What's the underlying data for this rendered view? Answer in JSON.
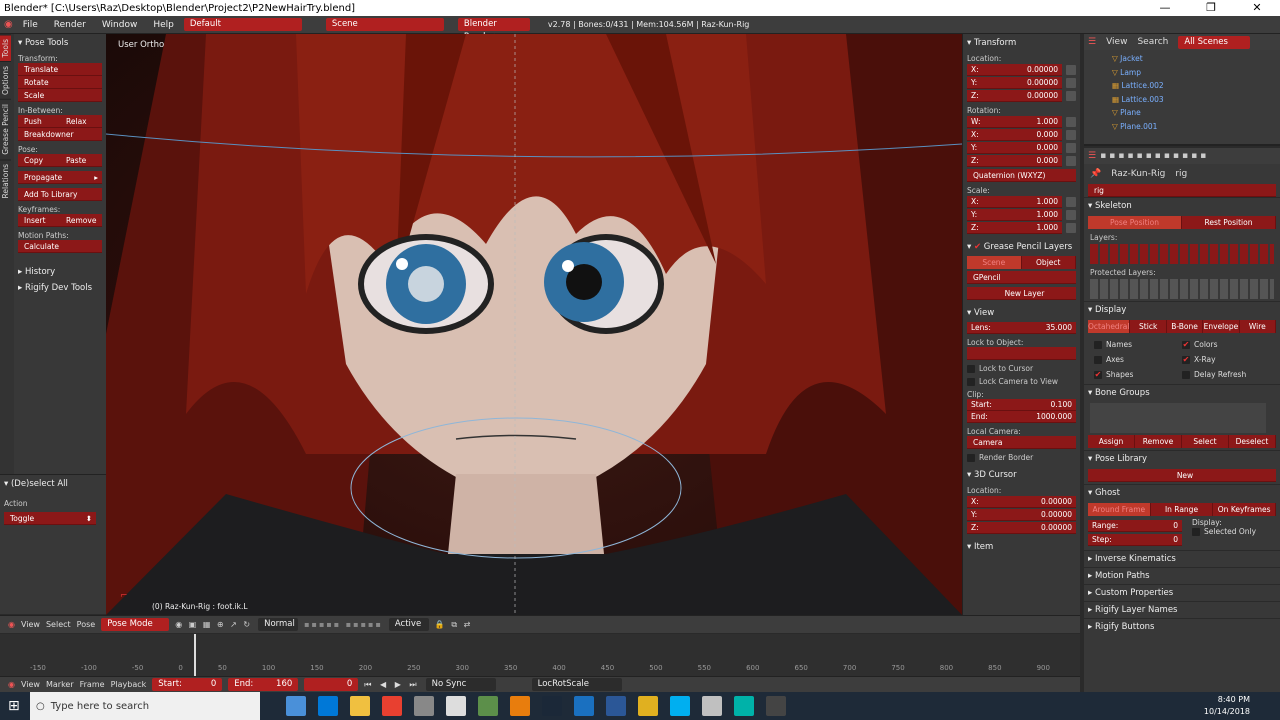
{
  "window": {
    "title": "Blender* [C:\\Users\\Raz\\Desktop\\Blender\\Project2\\P2NewHairTry.blend]",
    "controls": [
      "—",
      "❐",
      "✕"
    ]
  },
  "infobar": {
    "menus": [
      "File",
      "Render",
      "Window",
      "Help"
    ],
    "layout": "Default",
    "scene": "Scene",
    "engine": "Blender Render",
    "stats": "v2.78 | Bones:0/431 | Mem:104.56M | Raz-Kun-Rig"
  },
  "left_tabs": [
    "Tools",
    "Options",
    "Grease Pencil",
    "Relations"
  ],
  "toolshelf": {
    "header": "Pose Tools",
    "transform_label": "Transform:",
    "translate": "Translate",
    "rotate": "Rotate",
    "scale": "Scale",
    "inbetween_label": "In-Between:",
    "push": "Push",
    "relax": "Relax",
    "breakdowner": "Breakdowner",
    "pose_label": "Pose:",
    "copy": "Copy",
    "paste": "Paste",
    "propagate": "Propagate",
    "add_to_library": "Add To Library",
    "keyframes_label": "Keyframes:",
    "insert": "Insert",
    "remove": "Remove",
    "motion_paths_label": "Motion Paths:",
    "calculate": "Calculate",
    "history": "History",
    "rigify": "Rigify Dev Tools"
  },
  "operator": {
    "header": "(De)select All",
    "action_label": "Action",
    "action_value": "Toggle"
  },
  "viewport": {
    "view_label": "User Ortho",
    "object_info": "(0) Raz-Kun-Rig : foot.ik.L"
  },
  "npanel": {
    "transform": "Transform",
    "location": "Location:",
    "loc": [
      {
        "k": "X:",
        "v": "0.00000"
      },
      {
        "k": "Y:",
        "v": "0.00000"
      },
      {
        "k": "Z:",
        "v": "0.00000"
      }
    ],
    "rotation": "Rotation:",
    "rot": [
      {
        "k": "W:",
        "v": "1.000"
      },
      {
        "k": "X:",
        "v": "0.000"
      },
      {
        "k": "Y:",
        "v": "0.000"
      },
      {
        "k": "Z:",
        "v": "0.000"
      }
    ],
    "rot_mode": "Quaternion (WXYZ)",
    "scale": "Scale:",
    "scl": [
      {
        "k": "X:",
        "v": "1.000"
      },
      {
        "k": "Y:",
        "v": "1.000"
      },
      {
        "k": "Z:",
        "v": "1.000"
      }
    ],
    "gp_layers": "Grease Pencil Layers",
    "gp_scene": "Scene",
    "gp_object": "Object",
    "gp_name": "GPencil",
    "new_layer": "New Layer",
    "view": "View",
    "lens_label": "Lens:",
    "lens": "35.000",
    "lock_to_object": "Lock to Object:",
    "lock_to_cursor": "Lock to Cursor",
    "lock_camera": "Lock Camera to View",
    "clip": "Clip:",
    "start_label": "Start:",
    "clip_start": "0.100",
    "end_label": "End:",
    "clip_end": "1000.000",
    "local_camera": "Local Camera:",
    "camera": "Camera",
    "render_border": "Render Border",
    "cursor": "3D Cursor",
    "cursor_location": "Location:",
    "cur": [
      {
        "k": "X:",
        "v": "0.00000"
      },
      {
        "k": "Y:",
        "v": "0.00000"
      },
      {
        "k": "Z:",
        "v": "0.00000"
      }
    ],
    "item": "Item"
  },
  "outliner": {
    "menus": [
      "View",
      "Search"
    ],
    "filter": "All Scenes",
    "items": [
      "Jacket",
      "Lamp",
      "Lattice.002",
      "Lattice.003",
      "Plane",
      "Plane.001"
    ]
  },
  "props": {
    "object": "Raz-Kun-Rig",
    "data": "rig",
    "name_field": "rig",
    "skeleton": "Skeleton",
    "pose_position": "Pose Position",
    "rest_position": "Rest Position",
    "layers": "Layers:",
    "protected_layers": "Protected Layers:",
    "display": "Display",
    "display_modes": [
      "Octahedral",
      "Stick",
      "B-Bone",
      "Envelope",
      "Wire"
    ],
    "names": "Names",
    "colors": "Colors",
    "axes": "Axes",
    "xray": "X-Ray",
    "shapes": "Shapes",
    "delay_refresh": "Delay Refresh",
    "bone_groups": "Bone Groups",
    "assign": "Assign",
    "remove": "Remove",
    "select": "Select",
    "deselect": "Deselect",
    "pose_library": "Pose Library",
    "new": "New",
    "ghost": "Ghost",
    "ghost_modes": [
      "Around Frame",
      "In Range",
      "On Keyframes"
    ],
    "range_label": "Range:",
    "range": "0",
    "step_label": "Step:",
    "step": "0",
    "display_label": "Display:",
    "selected_only": "Selected Only",
    "collapsed": [
      "Inverse Kinematics",
      "Motion Paths",
      "Custom Properties",
      "Rigify Layer Names",
      "Rigify Buttons"
    ]
  },
  "view3d_header": {
    "menus": [
      "View",
      "Select",
      "Pose"
    ],
    "mode": "Pose Mode",
    "normal": "Normal",
    "active": "Active"
  },
  "timeline": {
    "ticks": [
      "-150",
      "-100",
      "-50",
      "0",
      "50",
      "100",
      "150",
      "200",
      "250",
      "300",
      "350",
      "400",
      "450",
      "500",
      "550",
      "600",
      "650",
      "700",
      "750",
      "800",
      "850",
      "900"
    ]
  },
  "timeline_header": {
    "menus": [
      "View",
      "Marker",
      "Frame",
      "Playback"
    ],
    "start_label": "Start:",
    "start": "0",
    "end_label": "End:",
    "end": "160",
    "current": "0",
    "sync": "No Sync",
    "keying": "LocRotScale"
  },
  "taskbar": {
    "search": "Type here to search",
    "time": "8:40 PM",
    "date": "10/14/2018"
  }
}
